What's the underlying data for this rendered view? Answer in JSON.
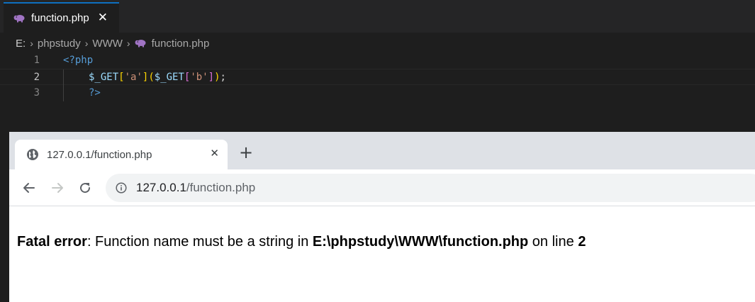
{
  "editor": {
    "tab": {
      "label": "function.php",
      "close_glyph": "✕",
      "icon": "php-elephant-icon"
    },
    "breadcrumb": {
      "drive": "E:",
      "folder1": "phpstudy",
      "folder2": "WWW",
      "file": "function.php",
      "separator": "›"
    },
    "lines": [
      {
        "number": "1",
        "active": false
      },
      {
        "number": "2",
        "active": true
      },
      {
        "number": "3",
        "active": false
      }
    ],
    "code": {
      "line1": "<?php",
      "line2_tokens": [
        "$_GET",
        "[",
        "'a'",
        "]",
        "(",
        "$_GET",
        "[",
        "'b'",
        "]",
        ")",
        ";"
      ],
      "line3": "?>"
    },
    "colors": {
      "background": "#1e1e1e",
      "tab_accent": "#0e70c0",
      "php_tag": "#569cd6",
      "variable": "#9cdcfe",
      "string": "#ce9178"
    }
  },
  "browser": {
    "tab": {
      "title": "127.0.0.1/function.php",
      "close_glyph": "✕",
      "icon": "globe-icon"
    },
    "new_tab_glyph": "+",
    "nav": {
      "back": "back-arrow-icon",
      "forward": "forward-arrow-icon",
      "reload": "reload-icon"
    },
    "address": {
      "host": "127.0.0.1",
      "path": "/function.php",
      "icon": "info-icon"
    },
    "page": {
      "error_label": "Fatal error",
      "message_prefix": ": Function name must be a string in ",
      "file_path": "E:\\phpstudy\\WWW\\function.php",
      "on_line_text": " on line ",
      "line_number": "2"
    }
  }
}
